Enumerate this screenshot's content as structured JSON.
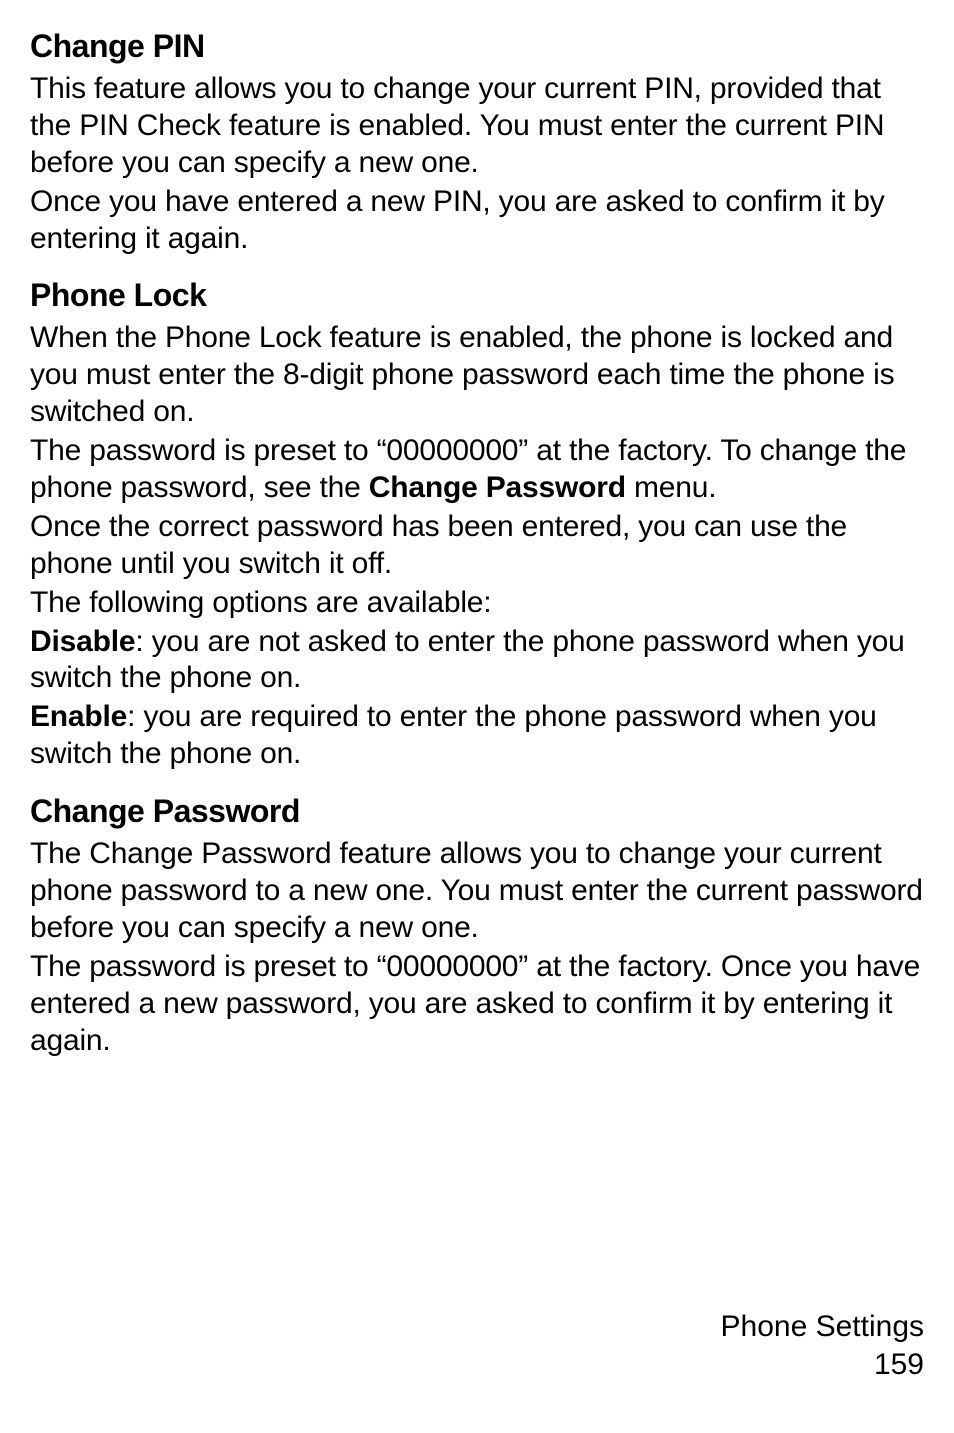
{
  "section1": {
    "heading": "Change PIN",
    "p1": "This feature allows you to change your current PIN, provided that the PIN Check feature is enabled. You must enter the current PIN before you can specify a new one.",
    "p2": "Once you have entered a new PIN, you are asked to confirm it by entering it again."
  },
  "section2": {
    "heading": "Phone Lock",
    "p1": "When the Phone Lock feature is enabled, the phone is locked and you must enter the 8-digit phone password each time the phone is switched on.",
    "p2a": "The password is preset to “00000000” at the factory. To change the phone password, see the ",
    "p2b_bold": "Change Password",
    "p2c": " menu.",
    "p3": "Once the correct password has been entered, you can use the phone until you switch it off.",
    "p4": "The following options are available:",
    "p5a_bold": "Disable",
    "p5b": ": you are not asked to enter the phone password when you switch the phone on.",
    "p6a_bold": "Enable",
    "p6b": ": you are required to enter the phone password when you switch the phone on."
  },
  "section3": {
    "heading": "Change Password",
    "p1": "The Change Password feature allows you to change your current phone password to a new one. You must enter the current password before you can specify a new one.",
    "p2": "The password is preset to “00000000” at the factory. Once you have entered a new password, you are asked to confirm it by entering it again."
  },
  "footer": {
    "chapter": "Phone Settings",
    "page": "159"
  }
}
